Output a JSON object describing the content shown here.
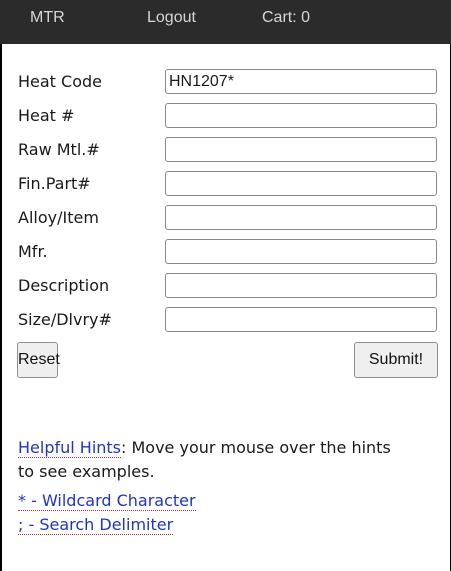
{
  "nav": {
    "mtr": "MTR",
    "logout": "Logout",
    "cart": "Cart: 0"
  },
  "form": {
    "fields": [
      {
        "label": "Heat Code",
        "value": "HN1207*"
      },
      {
        "label": "Heat #",
        "value": ""
      },
      {
        "label": "Raw Mtl.#",
        "value": ""
      },
      {
        "label": "Fin.Part#",
        "value": ""
      },
      {
        "label": "Alloy/Item",
        "value": ""
      },
      {
        "label": "Mfr.",
        "value": ""
      },
      {
        "label": "Description",
        "value": ""
      },
      {
        "label": "Size/Dlvry#",
        "value": ""
      }
    ],
    "reset_label": "Reset",
    "submit_label": "Submit!"
  },
  "hints": {
    "title": "Helpful Hints",
    "text_1": ": Move your mouse over the hints",
    "text_2": "to see examples.",
    "wildcard": "* - Wildcard Character",
    "delimiter": "; - Search Delimiter"
  },
  "colors": {
    "navbar_bg": "#2b2b2b",
    "nav_text": "#d6d6d6",
    "hint_link": "#1f34c4",
    "hint_underline": "#cc2244"
  }
}
